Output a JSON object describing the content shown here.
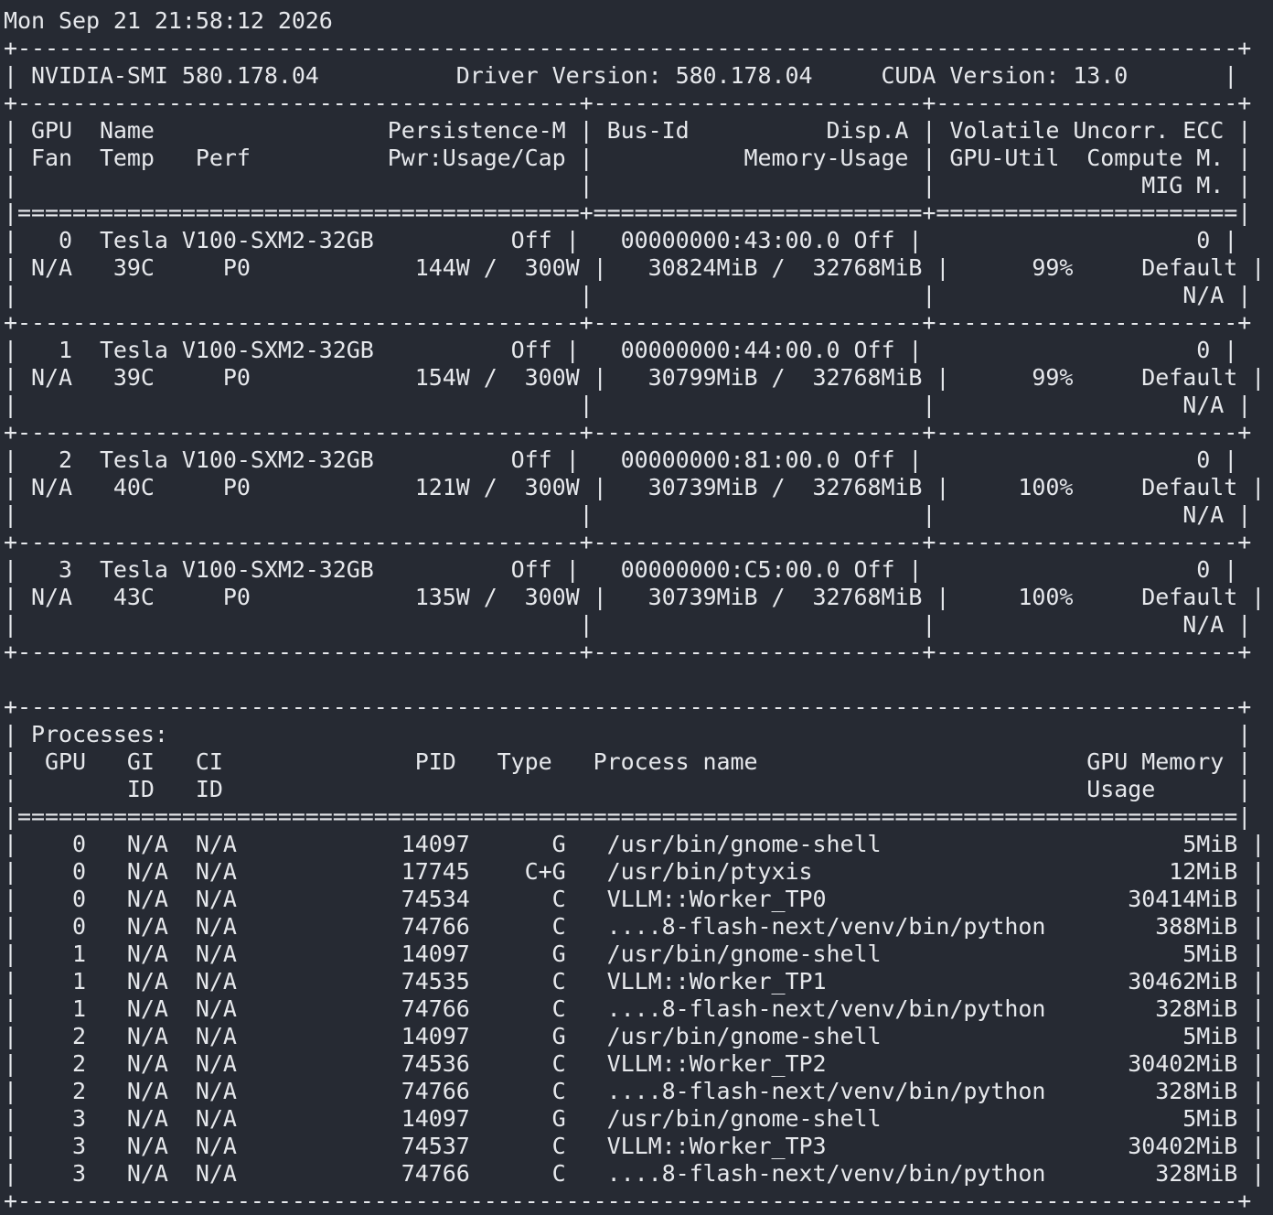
{
  "timestamp": "Mon Sep 21 21:58:12 2026",
  "header": {
    "smi_version": "NVIDIA-SMI 580.178.04",
    "driver_version": "Driver Version: 580.178.04",
    "cuda_version": "CUDA Version: 13.0"
  },
  "gpu_table_headers": [
    "| GPU  Name                 Persistence-M | Bus-Id          Disp.A | Volatile Uncorr. ECC |",
    "| Fan  Temp   Perf          Pwr:Usage/Cap |           Memory-Usage | GPU-Util  Compute M. |",
    "|                                         |                        |               MIG M. |"
  ],
  "gpus": [
    {
      "index": "0",
      "name": "Tesla V100-SXM2-32GB",
      "persistence": "Off",
      "fan": "N/A",
      "temp": "39C",
      "perf": "P0",
      "pwr_usage": "144W",
      "pwr_cap": "300W",
      "bus_id": "00000000:43:00.0",
      "disp_a": "Off",
      "mem_used": "30824MiB",
      "mem_total": "32768MiB",
      "gpu_util": "99%",
      "ecc": "0",
      "compute_mode": "Default",
      "mig_mode": "N/A"
    },
    {
      "index": "1",
      "name": "Tesla V100-SXM2-32GB",
      "persistence": "Off",
      "fan": "N/A",
      "temp": "39C",
      "perf": "P0",
      "pwr_usage": "154W",
      "pwr_cap": "300W",
      "bus_id": "00000000:44:00.0",
      "disp_a": "Off",
      "mem_used": "30799MiB",
      "mem_total": "32768MiB",
      "gpu_util": "99%",
      "ecc": "0",
      "compute_mode": "Default",
      "mig_mode": "N/A"
    },
    {
      "index": "2",
      "name": "Tesla V100-SXM2-32GB",
      "persistence": "Off",
      "fan": "N/A",
      "temp": "40C",
      "perf": "P0",
      "pwr_usage": "121W",
      "pwr_cap": "300W",
      "bus_id": "00000000:81:00.0",
      "disp_a": "Off",
      "mem_used": "30739MiB",
      "mem_total": "32768MiB",
      "gpu_util": "100%",
      "ecc": "0",
      "compute_mode": "Default",
      "mig_mode": "N/A"
    },
    {
      "index": "3",
      "name": "Tesla V100-SXM2-32GB",
      "persistence": "Off",
      "fan": "N/A",
      "temp": "43C",
      "perf": "P0",
      "pwr_usage": "135W",
      "pwr_cap": "300W",
      "bus_id": "00000000:C5:00.0",
      "disp_a": "Off",
      "mem_used": "30739MiB",
      "mem_total": "32768MiB",
      "gpu_util": "100%",
      "ecc": "0",
      "compute_mode": "Default",
      "mig_mode": "N/A"
    }
  ],
  "processes": {
    "title": "Processes:",
    "headers": [
      "|  GPU   GI   CI              PID   Type   Process name                        GPU Memory |",
      "|        ID   ID                                                               Usage      |"
    ],
    "rows": [
      {
        "gpu": "0",
        "gi": "N/A",
        "ci": "N/A",
        "pid": "14097",
        "type": "G",
        "name": "/usr/bin/gnome-shell",
        "mem": "5MiB"
      },
      {
        "gpu": "0",
        "gi": "N/A",
        "ci": "N/A",
        "pid": "17745",
        "type": "C+G",
        "name": "/usr/bin/ptyxis",
        "mem": "12MiB"
      },
      {
        "gpu": "0",
        "gi": "N/A",
        "ci": "N/A",
        "pid": "74534",
        "type": "C",
        "name": "VLLM::Worker_TP0",
        "mem": "30414MiB"
      },
      {
        "gpu": "0",
        "gi": "N/A",
        "ci": "N/A",
        "pid": "74766",
        "type": "C",
        "name": "....8-flash-next/venv/bin/python",
        "mem": "388MiB"
      },
      {
        "gpu": "1",
        "gi": "N/A",
        "ci": "N/A",
        "pid": "14097",
        "type": "G",
        "name": "/usr/bin/gnome-shell",
        "mem": "5MiB"
      },
      {
        "gpu": "1",
        "gi": "N/A",
        "ci": "N/A",
        "pid": "74535",
        "type": "C",
        "name": "VLLM::Worker_TP1",
        "mem": "30462MiB"
      },
      {
        "gpu": "1",
        "gi": "N/A",
        "ci": "N/A",
        "pid": "74766",
        "type": "C",
        "name": "....8-flash-next/venv/bin/python",
        "mem": "328MiB"
      },
      {
        "gpu": "2",
        "gi": "N/A",
        "ci": "N/A",
        "pid": "14097",
        "type": "G",
        "name": "/usr/bin/gnome-shell",
        "mem": "5MiB"
      },
      {
        "gpu": "2",
        "gi": "N/A",
        "ci": "N/A",
        "pid": "74536",
        "type": "C",
        "name": "VLLM::Worker_TP2",
        "mem": "30402MiB"
      },
      {
        "gpu": "2",
        "gi": "N/A",
        "ci": "N/A",
        "pid": "74766",
        "type": "C",
        "name": "....8-flash-next/venv/bin/python",
        "mem": "328MiB"
      },
      {
        "gpu": "3",
        "gi": "N/A",
        "ci": "N/A",
        "pid": "14097",
        "type": "G",
        "name": "/usr/bin/gnome-shell",
        "mem": "5MiB"
      },
      {
        "gpu": "3",
        "gi": "N/A",
        "ci": "N/A",
        "pid": "74537",
        "type": "C",
        "name": "VLLM::Worker_TP3",
        "mem": "30402MiB"
      },
      {
        "gpu": "3",
        "gi": "N/A",
        "ci": "N/A",
        "pid": "74766",
        "type": "C",
        "name": "....8-flash-next/venv/bin/python",
        "mem": "328MiB"
      }
    ]
  },
  "colors": {
    "background": "#262a33",
    "foreground": "#e6e8ec"
  }
}
